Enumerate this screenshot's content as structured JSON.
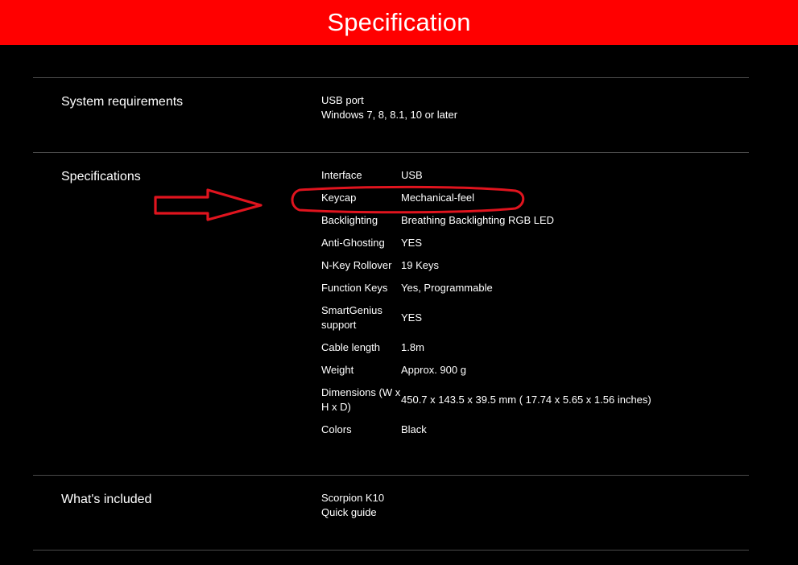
{
  "header": {
    "title": "Specification",
    "background_color": "#ff0000"
  },
  "sections": {
    "system_requirements": {
      "title": "System requirements",
      "items": [
        "USB port",
        "Windows 7, 8, 8.1, 10 or later"
      ]
    },
    "specifications": {
      "title": "Specifications",
      "rows": [
        {
          "key": "Interface",
          "value": "USB"
        },
        {
          "key": "Keycap",
          "value": "Mechanical-feel"
        },
        {
          "key": "Backlighting",
          "value": "Breathing Backlighting RGB LED"
        },
        {
          "key": "Anti-Ghosting",
          "value": "YES"
        },
        {
          "key": "N-Key Rollover",
          "value": "19 Keys"
        },
        {
          "key": "Function Keys",
          "value": "Yes, Programmable"
        },
        {
          "key": "SmartGenius support",
          "value": "YES"
        },
        {
          "key": "Cable length",
          "value": "1.8m"
        },
        {
          "key": "Weight",
          "value": "Approx. 900 g"
        },
        {
          "key": "Dimensions (W x H x D)",
          "value": "450.7 x 143.5 x 39.5 mm ( 17.74 x 5.65 x 1.56 inches)"
        },
        {
          "key": "Colors",
          "value": "Black"
        }
      ]
    },
    "whats_included": {
      "title": "What's included",
      "items": [
        "Scorpion K10",
        "Quick guide"
      ]
    }
  },
  "annotation": {
    "icon": "arrow-right-icon",
    "highlight": "keycap-row",
    "color": "#e0141e"
  }
}
